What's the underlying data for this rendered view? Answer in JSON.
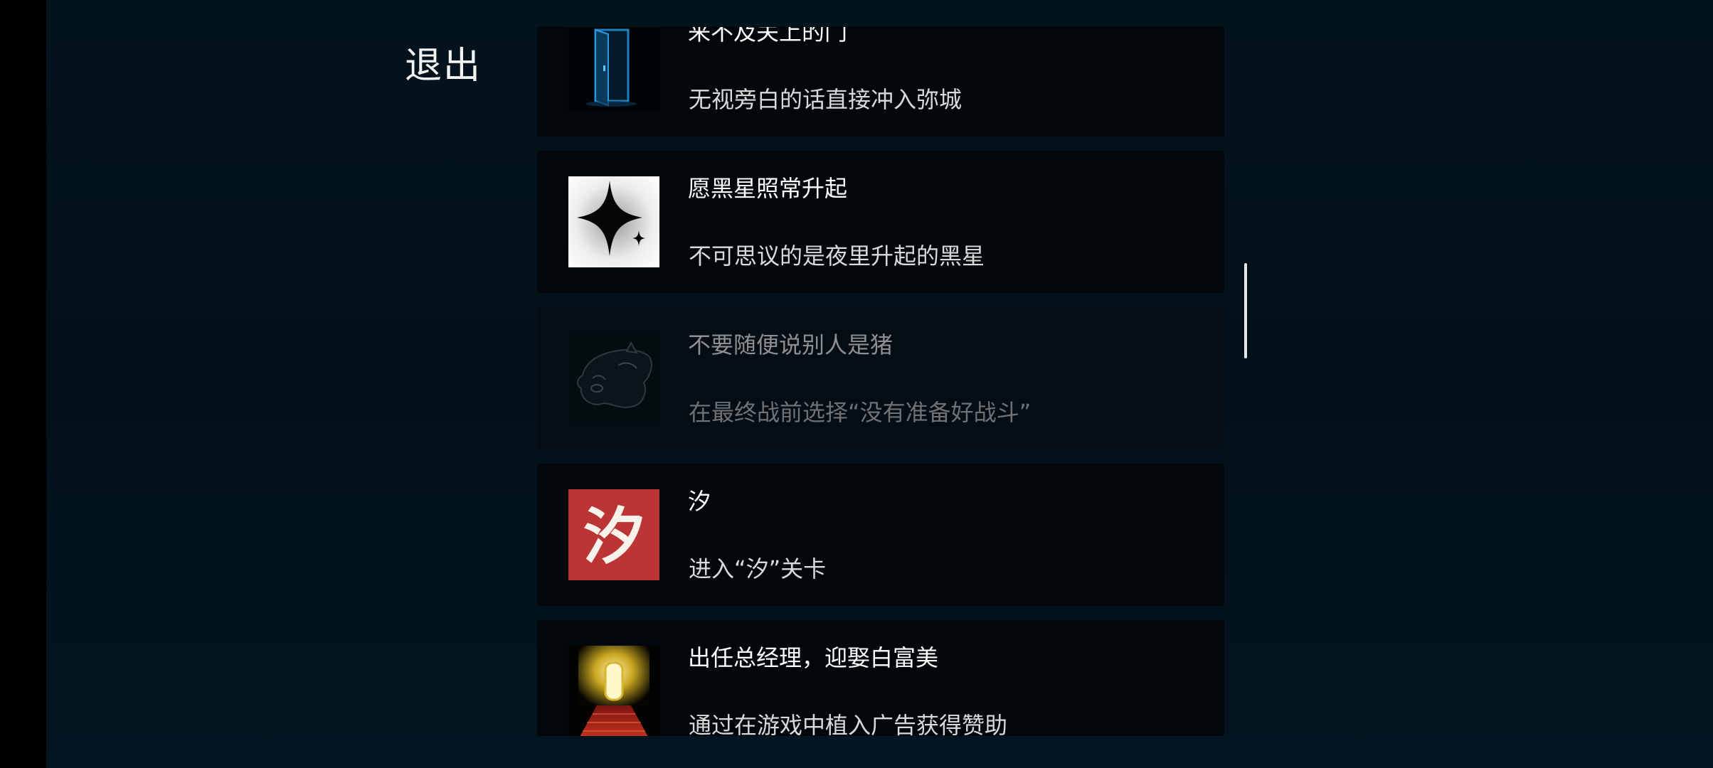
{
  "exit_label": "退出",
  "achievements": [
    {
      "icon": "door-icon",
      "title": "来不及关上的门",
      "description": "无视旁白的话直接冲入弥城",
      "locked": false
    },
    {
      "icon": "black-star-icon",
      "title": "愿黑星照常升起",
      "description": "不可思议的是夜里升起的黑星",
      "locked": false
    },
    {
      "icon": "pig-icon",
      "title": "不要随便说别人是猪",
      "description": "在最终战前选择“没有准备好战斗”",
      "locked": true
    },
    {
      "icon": "xi-character-icon",
      "icon_text": "汐",
      "title": "汐",
      "description": "进入“汐”关卡",
      "locked": false
    },
    {
      "icon": "red-carpet-door-icon",
      "title": "出任总经理，迎娶白富美",
      "description": "通过在游戏中植入广告获得赞助",
      "locked": false
    }
  ],
  "colors": {
    "background": "#021019",
    "card": "#02070b",
    "locked_text": "#8d8f91",
    "xi_red": "#c43a3a"
  }
}
